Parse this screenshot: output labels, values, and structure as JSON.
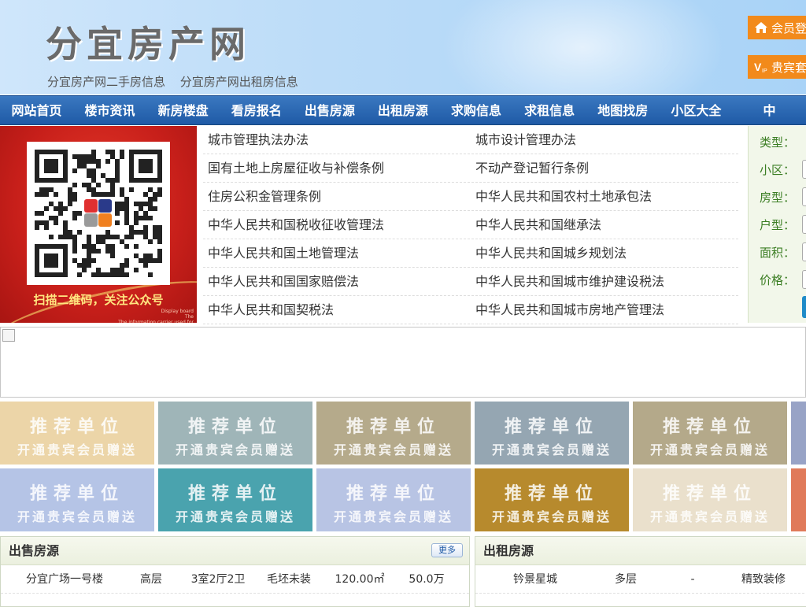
{
  "header": {
    "site_title": "分宜房产网",
    "sub_links": [
      "分宜房产网二手房信息",
      "分宜房产网出租房信息"
    ],
    "login_button": "会员登",
    "vip_button": "贵宾套"
  },
  "nav": {
    "items": [
      "网站首页",
      "楼市资讯",
      "新房楼盘",
      "看房报名",
      "出售房源",
      "出租房源",
      "求购信息",
      "求租信息",
      "地图找房",
      "小区大全",
      "中"
    ]
  },
  "qr_banner": {
    "caption": "扫描二维码，关注公众号",
    "small_text": "Display board\nThe\nThe information carrier used for"
  },
  "laws": [
    [
      "城市管理执法办法",
      "城市设计管理办法"
    ],
    [
      "国有土地上房屋征收与补偿条例",
      "不动产登记暂行条例"
    ],
    [
      "住房公积金管理条例",
      "中华人民共和国农村土地承包法"
    ],
    [
      "中华人民共和国税收征收管理法",
      "中华人民共和国继承法"
    ],
    [
      "中华人民共和国土地管理法",
      "中华人民共和国城乡规划法"
    ],
    [
      "中华人民共和国国家赔偿法",
      "中华人民共和国城市维护建设税法"
    ],
    [
      "中华人民共和国契税法",
      "中华人民共和国城市房地产管理法"
    ]
  ],
  "search": {
    "labels": [
      "类型：",
      "小区：",
      "房型：",
      "户型：",
      "面积：",
      "价格："
    ]
  },
  "tiles": {
    "line1": "推荐单位",
    "line2": "开通贵宾会员赠送",
    "colors_row1": [
      "#ecd5a8",
      "#9fb5b8",
      "#b5aa8b",
      "#95a6b2",
      "#b4a98a",
      "#98a3c6"
    ],
    "colors_row2": [
      "#b5c4e6",
      "#4aa3ae",
      "#b8c4e4",
      "#b78a2d",
      "#eae0cc",
      "#e07a5a"
    ]
  },
  "sale_panel": {
    "title": "出售房源",
    "more": "更多",
    "rows": [
      [
        "分宜广场一号楼",
        "高层",
        "3室2厅2卫",
        "毛坯未装",
        "120.00㎡",
        "50.0万"
      ]
    ]
  },
  "rent_panel": {
    "title": "出租房源",
    "rows": [
      [
        "钤景星城",
        "多层",
        "-",
        "精致装修"
      ]
    ]
  }
}
